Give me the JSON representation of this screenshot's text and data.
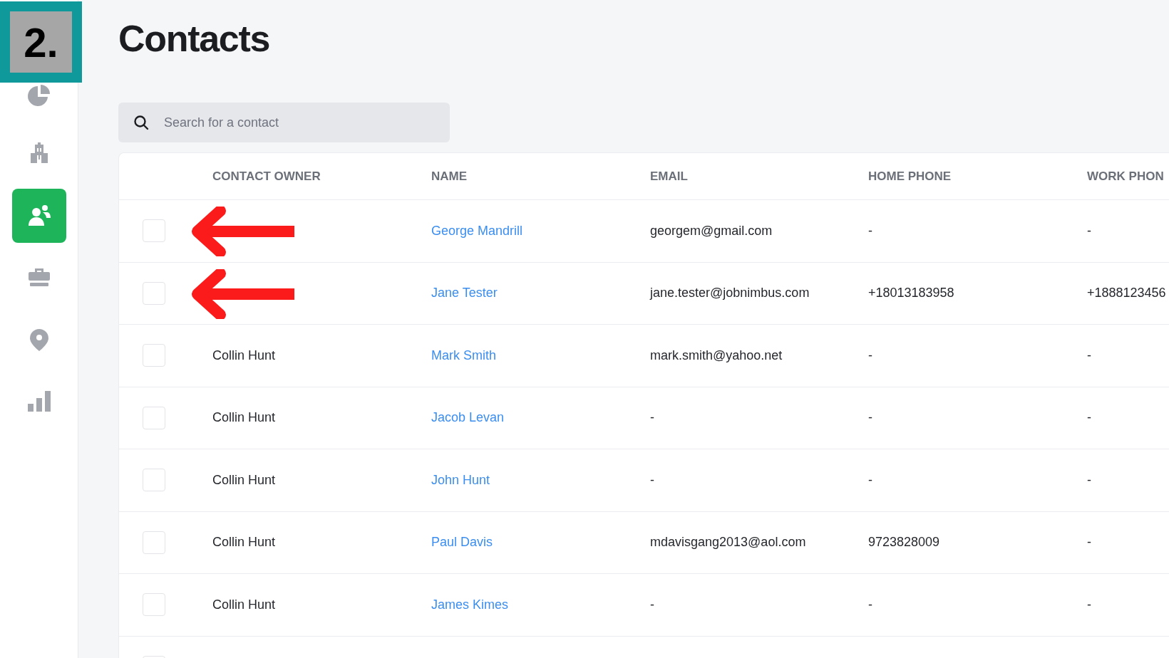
{
  "step_badge": "2.",
  "sidebar": {
    "items": [
      {
        "selected": false
      },
      {
        "selected": false
      },
      {
        "selected": true
      },
      {
        "selected": false
      },
      {
        "selected": false
      },
      {
        "selected": false
      }
    ]
  },
  "title": "Contacts",
  "search": {
    "placeholder": "Search for a contact"
  },
  "table": {
    "columns": [
      "CONTACT OWNER",
      "NAME",
      "EMAIL",
      "HOME PHONE",
      "WORK PHON"
    ],
    "rows": [
      {
        "checked": false,
        "annotated": true,
        "owner": "",
        "name": "George Mandrill",
        "email": "georgem@gmail.com",
        "home_phone": "-",
        "work_phone": "-"
      },
      {
        "checked": false,
        "annotated": true,
        "owner": "",
        "name": "Jane Tester",
        "email": "jane.tester@jobnimbus.com",
        "home_phone": "+18013183958",
        "work_phone": "+1888123456"
      },
      {
        "checked": false,
        "annotated": false,
        "owner": "Collin Hunt",
        "name": "Mark Smith",
        "email": "mark.smith@yahoo.net",
        "home_phone": "-",
        "work_phone": "-"
      },
      {
        "checked": false,
        "annotated": false,
        "owner": "Collin Hunt",
        "name": "Jacob Levan",
        "email": "-",
        "home_phone": "-",
        "work_phone": "-"
      },
      {
        "checked": false,
        "annotated": false,
        "owner": "Collin Hunt",
        "name": "John Hunt",
        "email": "-",
        "home_phone": "-",
        "work_phone": "-"
      },
      {
        "checked": false,
        "annotated": false,
        "owner": "Collin Hunt",
        "name": "Paul Davis",
        "email": "mdavisgang2013@aol.com",
        "home_phone": "9723828009",
        "work_phone": "-"
      },
      {
        "checked": false,
        "annotated": false,
        "owner": "Collin Hunt",
        "name": "James Kimes",
        "email": "-",
        "home_phone": "-",
        "work_phone": "-"
      },
      {
        "checked": false,
        "annotated": false,
        "owner": "",
        "name": "",
        "email": "",
        "home_phone": "",
        "work_phone": ""
      }
    ]
  }
}
